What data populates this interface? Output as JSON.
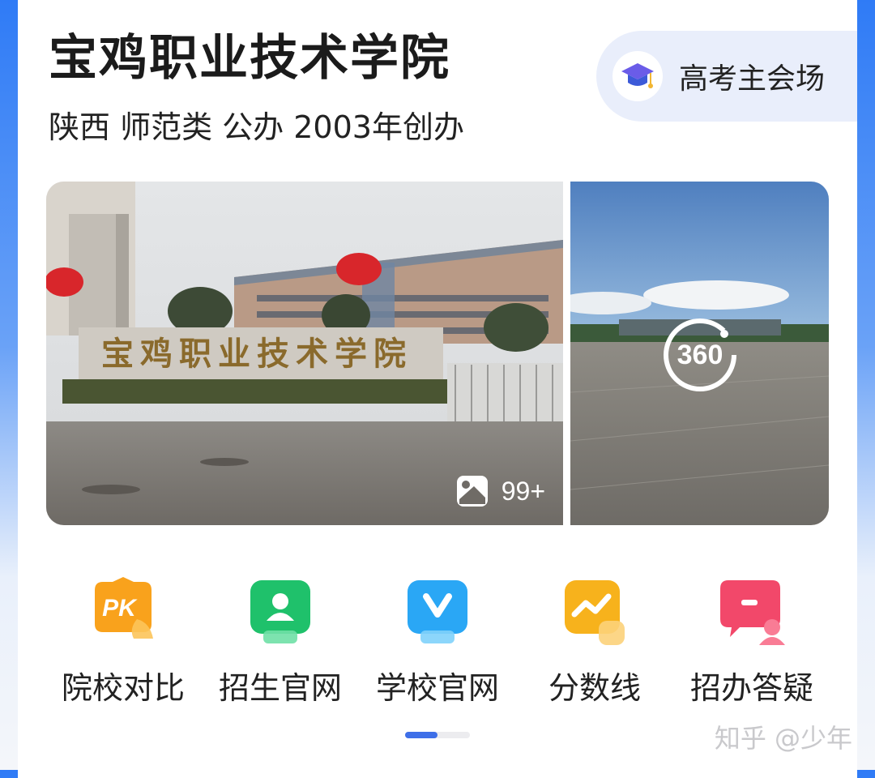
{
  "school": {
    "name": "宝鸡职业技术学院",
    "meta": "陕西 师范类 公办 2003年创办"
  },
  "promo": {
    "label": "高考主会场",
    "icon": "graduation-cap-icon"
  },
  "gallery": {
    "photo_count": "99+",
    "photo_sign_text": "宝鸡职业技术学院",
    "pano_label": "360"
  },
  "actions": [
    {
      "label": "院校对比",
      "icon": "pk-compare-icon",
      "color": "#f9a21c"
    },
    {
      "label": "招生官网",
      "icon": "admission-person-icon",
      "color": "#1fc16b"
    },
    {
      "label": "学校官网",
      "icon": "school-v-icon",
      "color": "#2aa7f5"
    },
    {
      "label": "分数线",
      "icon": "score-line-chart-icon",
      "color": "#f7b21c"
    },
    {
      "label": "招办答疑",
      "icon": "qa-chat-icon",
      "color": "#f2486a"
    }
  ],
  "pager": {
    "page": 1,
    "pages": 2
  },
  "watermark": "知乎 @少年"
}
